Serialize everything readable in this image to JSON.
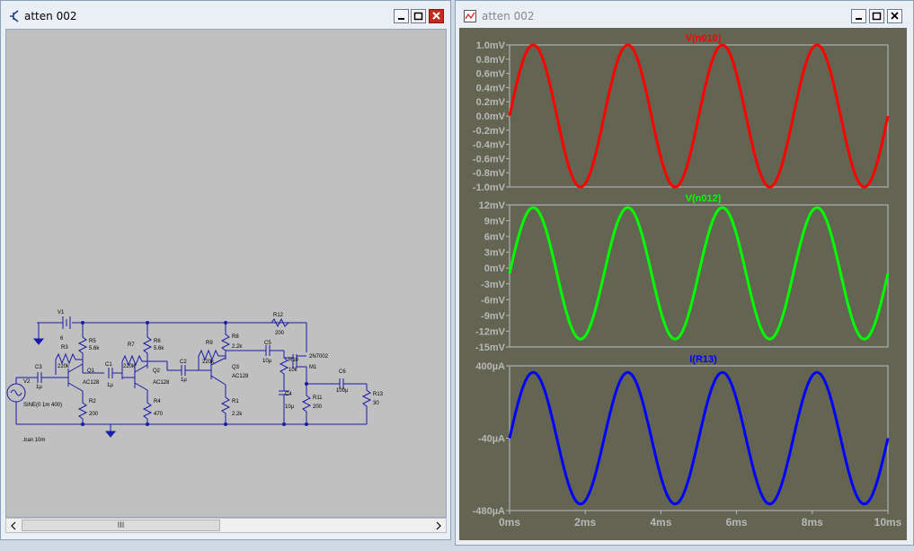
{
  "left_window": {
    "title": "atten 002",
    "icon": "transistor-icon",
    "schematic": {
      "components": {
        "V1": "V1",
        "V1_val": "6",
        "R3": "R3",
        "R3_val": "220k",
        "R5": "R5",
        "R5_val": "5.6k",
        "R7": "R7",
        "R7_val": "220k",
        "R6": "R6",
        "R6_val": "5.6k",
        "R9": "R9",
        "R9_val": "220k",
        "R8": "R8",
        "R8_val": "2.2k",
        "R12": "R12",
        "R12_val": "200",
        "C3": "C3",
        "C3_val": "1µ",
        "C1": "C1",
        "C1_val": "1µ",
        "C2": "C2",
        "C2_val": "1µ",
        "C5": "C5",
        "C5_val": "10µ",
        "C4": "C4",
        "C4_val": "10µ",
        "C6": "C6",
        "C6_val": "100µ",
        "Q1": "Q1",
        "Q1_val": "AC128",
        "Q2": "Q2",
        "Q2_val": "AC128",
        "Q3": "Q3",
        "Q3_val": "AC128",
        "M1": "M1",
        "M1_val": "2N7002",
        "R10": "R10",
        "R10_val": "10k",
        "R11": "R11",
        "R11_val": "200",
        "R13": "R13",
        "R13_val": "30",
        "R2": "R2",
        "R2_val": "200",
        "R4": "R4",
        "R4_val": "470",
        "R1": "R1",
        "R1_val": "2.2k",
        "V2": "V2",
        "V2_val": "SINE(0 1m 400)"
      },
      "directive": ".tran 10m"
    },
    "scrollbar_thumb": "III"
  },
  "right_window": {
    "title": "atten 002",
    "icon": "waveform-icon"
  },
  "chart_data": [
    {
      "type": "line",
      "title": "V(n010)",
      "color": "#ff0000",
      "x": [
        0,
        10
      ],
      "yticks": [
        "1.0mV",
        "0.8mV",
        "0.6mV",
        "0.4mV",
        "0.2mV",
        "0.0mV",
        "-0.2mV",
        "-0.4mV",
        "-0.6mV",
        "-0.8mV",
        "-1.0mV"
      ],
      "ylim": [
        -1.0,
        1.0
      ],
      "series": [
        {
          "amplitude": 1.0,
          "offset": 0.0,
          "frequency_hz": 400,
          "phase_deg": 0
        }
      ]
    },
    {
      "type": "line",
      "title": "V(n012)",
      "color": "#00ff00",
      "yticks": [
        "12mV",
        "9mV",
        "6mV",
        "3mV",
        "0mV",
        "-3mV",
        "-6mV",
        "-9mV",
        "-12mV",
        "-15mV"
      ],
      "ylim": [
        -15,
        12
      ],
      "series": [
        {
          "amplitude": 12.5,
          "offset": -1.0,
          "frequency_hz": 400,
          "phase_deg": 0
        }
      ]
    },
    {
      "type": "line",
      "title": "I(R13)",
      "color": "#0000ff",
      "yticks": [
        "400µA",
        "-40µA",
        "-480µA"
      ],
      "ylim": [
        -480,
        400
      ],
      "series": [
        {
          "amplitude": 400,
          "offset": -40,
          "frequency_hz": 400,
          "phase_deg": 0
        }
      ],
      "xticks": [
        "0ms",
        "2ms",
        "4ms",
        "6ms",
        "8ms",
        "10ms"
      ],
      "xlim": [
        0,
        10
      ]
    }
  ]
}
